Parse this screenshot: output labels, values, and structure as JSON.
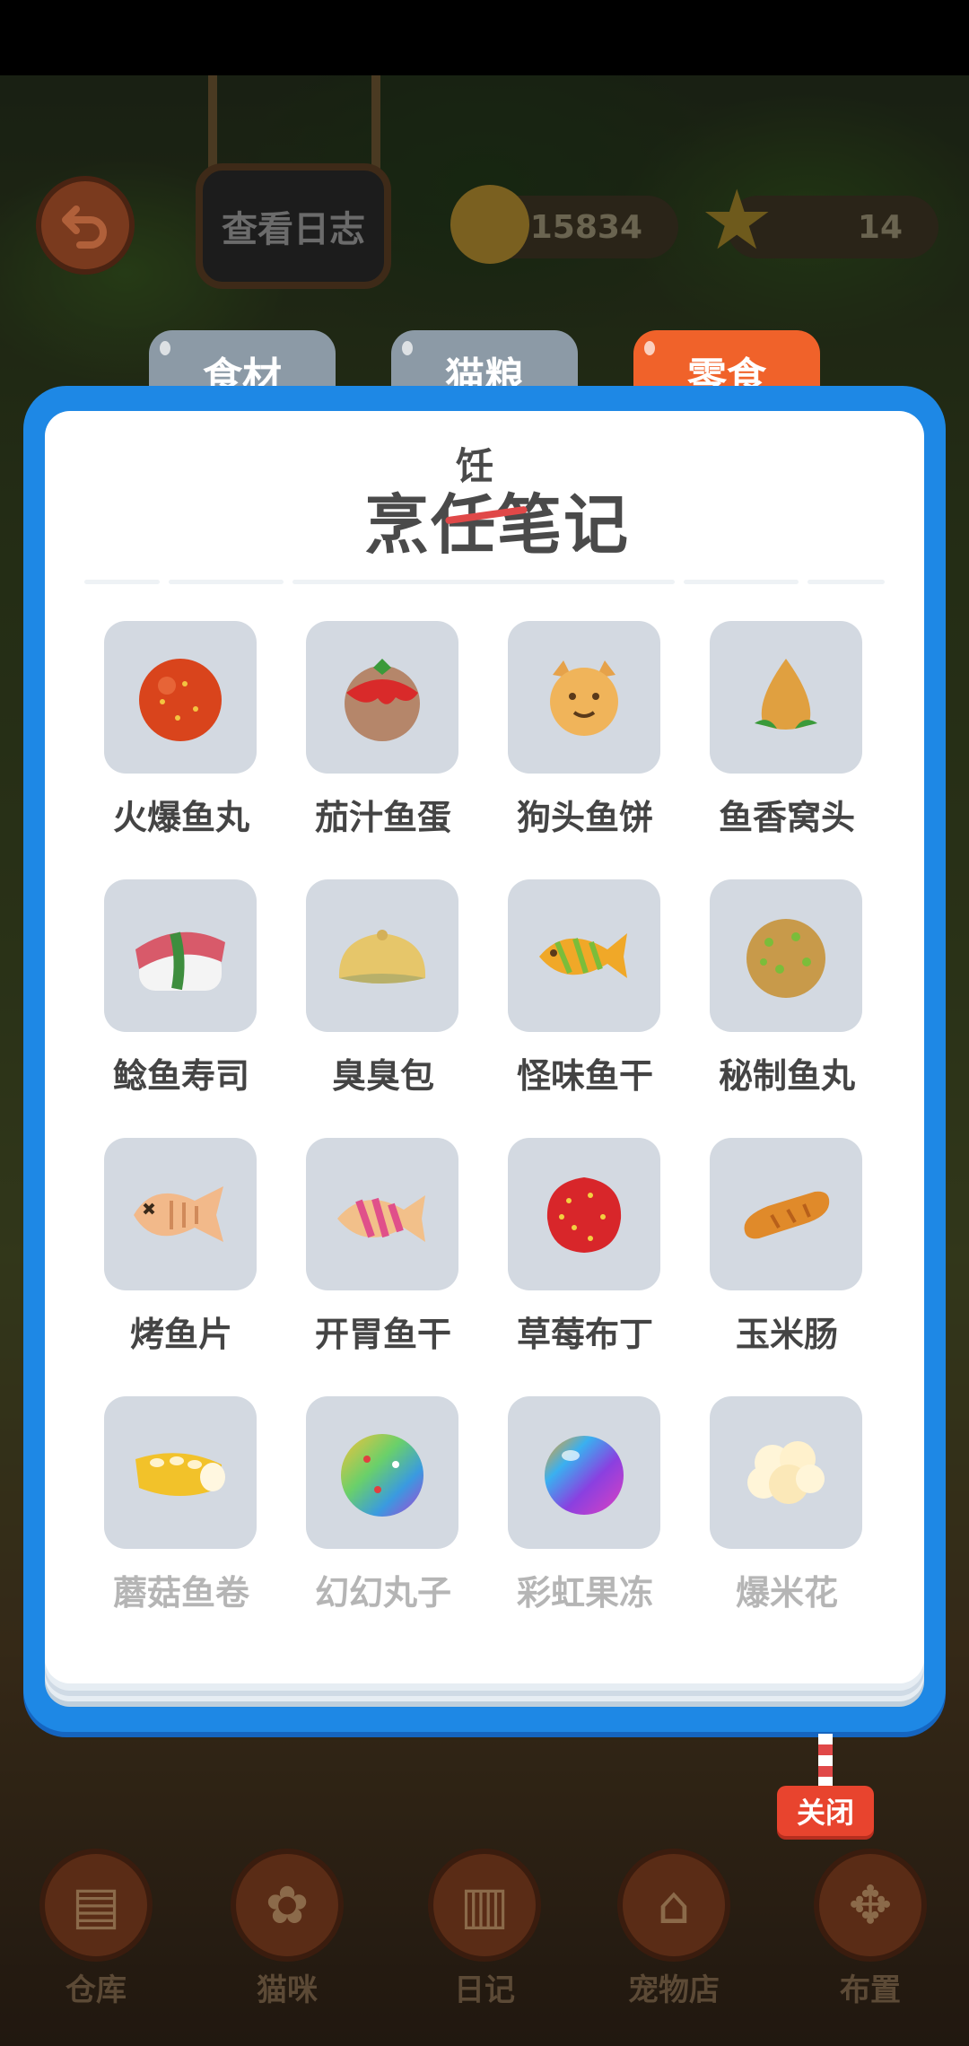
{
  "hud": {
    "log_sign": "查看日志",
    "coins": "15834",
    "stars": "14"
  },
  "tabs": [
    {
      "label": "食材",
      "active": false
    },
    {
      "label": "猫粮",
      "active": false
    },
    {
      "label": "零食",
      "active": true
    }
  ],
  "panel": {
    "title": "烹任笔记",
    "title_correction": "饪"
  },
  "items": [
    {
      "name": "火爆鱼丸",
      "icon": "spicy-fishball-icon",
      "locked": false
    },
    {
      "name": "茄汁鱼蛋",
      "icon": "tomato-fish-egg-icon",
      "locked": false
    },
    {
      "name": "狗头鱼饼",
      "icon": "dog-head-fishcake-icon",
      "locked": false
    },
    {
      "name": "鱼香窝头",
      "icon": "fish-wotou-icon",
      "locked": false
    },
    {
      "name": "鲶鱼寿司",
      "icon": "catfish-sushi-icon",
      "locked": false
    },
    {
      "name": "臭臭包",
      "icon": "stinky-bun-icon",
      "locked": false
    },
    {
      "name": "怪味鱼干",
      "icon": "strange-dried-fish-icon",
      "locked": false
    },
    {
      "name": "秘制鱼丸",
      "icon": "secret-fishball-icon",
      "locked": false
    },
    {
      "name": "烤鱼片",
      "icon": "grilled-fish-icon",
      "locked": false
    },
    {
      "name": "开胃鱼干",
      "icon": "appetizer-dried-fish-icon",
      "locked": false
    },
    {
      "name": "草莓布丁",
      "icon": "strawberry-pudding-icon",
      "locked": false
    },
    {
      "name": "玉米肠",
      "icon": "corn-sausage-icon",
      "locked": false
    },
    {
      "name": "蘑菇鱼卷",
      "icon": "mushroom-fish-roll-icon",
      "locked": true
    },
    {
      "name": "幻幻丸子",
      "icon": "magic-ball-icon",
      "locked": true
    },
    {
      "name": "彩虹果冻",
      "icon": "rainbow-jelly-icon",
      "locked": true
    },
    {
      "name": "爆米花",
      "icon": "popcorn-icon",
      "locked": true
    }
  ],
  "close_label": "关闭",
  "bottom_nav": [
    {
      "label": "仓库",
      "icon": "warehouse-icon"
    },
    {
      "label": "猫咪",
      "icon": "paw-icon"
    },
    {
      "label": "日记",
      "icon": "diary-icon"
    },
    {
      "label": "宠物店",
      "icon": "pet-shop-icon"
    },
    {
      "label": "布置",
      "icon": "arrange-icon"
    }
  ]
}
